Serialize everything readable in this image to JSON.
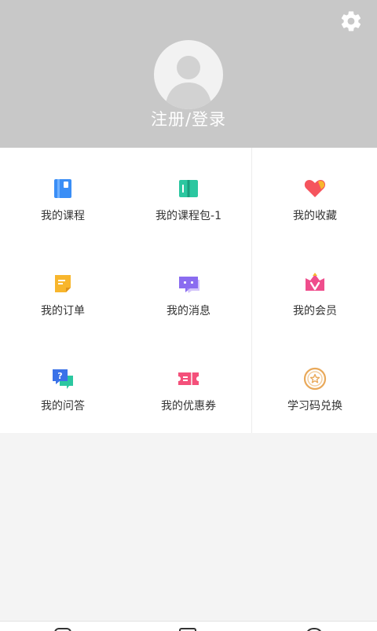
{
  "header": {
    "login_label": "注册/登录",
    "settings_icon": "gear-icon",
    "avatar_icon": "default-avatar-icon",
    "background": "#c8c8c8"
  },
  "menu": [
    {
      "label": "我的课程",
      "icon": "course-book-icon",
      "color": "#3a8ef6"
    },
    {
      "label": "我的课程包-1",
      "icon": "course-package-icon",
      "color": "#2bc7a0"
    },
    {
      "label": "我的收藏",
      "icon": "heart-favorite-icon",
      "color": "#f5545d"
    },
    {
      "label": "我的订单",
      "icon": "order-note-icon",
      "color": "#f8b62d"
    },
    {
      "label": "我的消息",
      "icon": "message-bubble-icon",
      "color": "#8a6cf0"
    },
    {
      "label": "我的会员",
      "icon": "vip-crown-icon",
      "color": "#ef4d8c"
    },
    {
      "label": "我的问答",
      "icon": "qa-bubble-icon",
      "color": "#3a72e8"
    },
    {
      "label": "我的优惠券",
      "icon": "coupon-ticket-icon",
      "color": "#f4507a"
    },
    {
      "label": "学习码兑换",
      "icon": "redeem-star-icon",
      "color": "#e9a95a"
    }
  ],
  "bottom_nav": {
    "tabs": [
      "home-tab-icon",
      "course-tab-icon",
      "profile-tab-icon"
    ]
  }
}
